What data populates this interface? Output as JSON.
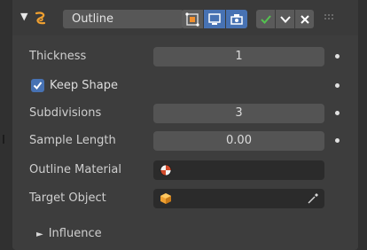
{
  "modifier": {
    "name": "Outline",
    "icon": "grease-pencil-modifier-icon",
    "toggles": [
      {
        "icon": "edit-mode-icon",
        "active": false
      },
      {
        "icon": "viewport-icon",
        "active": true
      },
      {
        "icon": "render-icon",
        "active": true
      }
    ],
    "apply_icons": [
      "checkmark-icon",
      "chevron-down-icon",
      "close-icon"
    ]
  },
  "properties": {
    "thickness": {
      "label": "Thickness",
      "value": "1"
    },
    "keep_shape": {
      "label": "Keep Shape",
      "checked": true
    },
    "subdivisions": {
      "label": "Subdivisions",
      "value": "3"
    },
    "sample_length": {
      "label": "Sample Length",
      "value": "0.00"
    },
    "outline_material": {
      "label": "Outline Material",
      "value": ""
    },
    "target_object": {
      "label": "Target Object",
      "value": ""
    }
  },
  "subpanels": {
    "influence": {
      "label": "Influence",
      "expanded": false
    }
  },
  "colors": {
    "accent": "#4772b3",
    "panel_bg": "#3d3d3d",
    "field_bg": "#545454",
    "apply_green": "#53c24f"
  }
}
